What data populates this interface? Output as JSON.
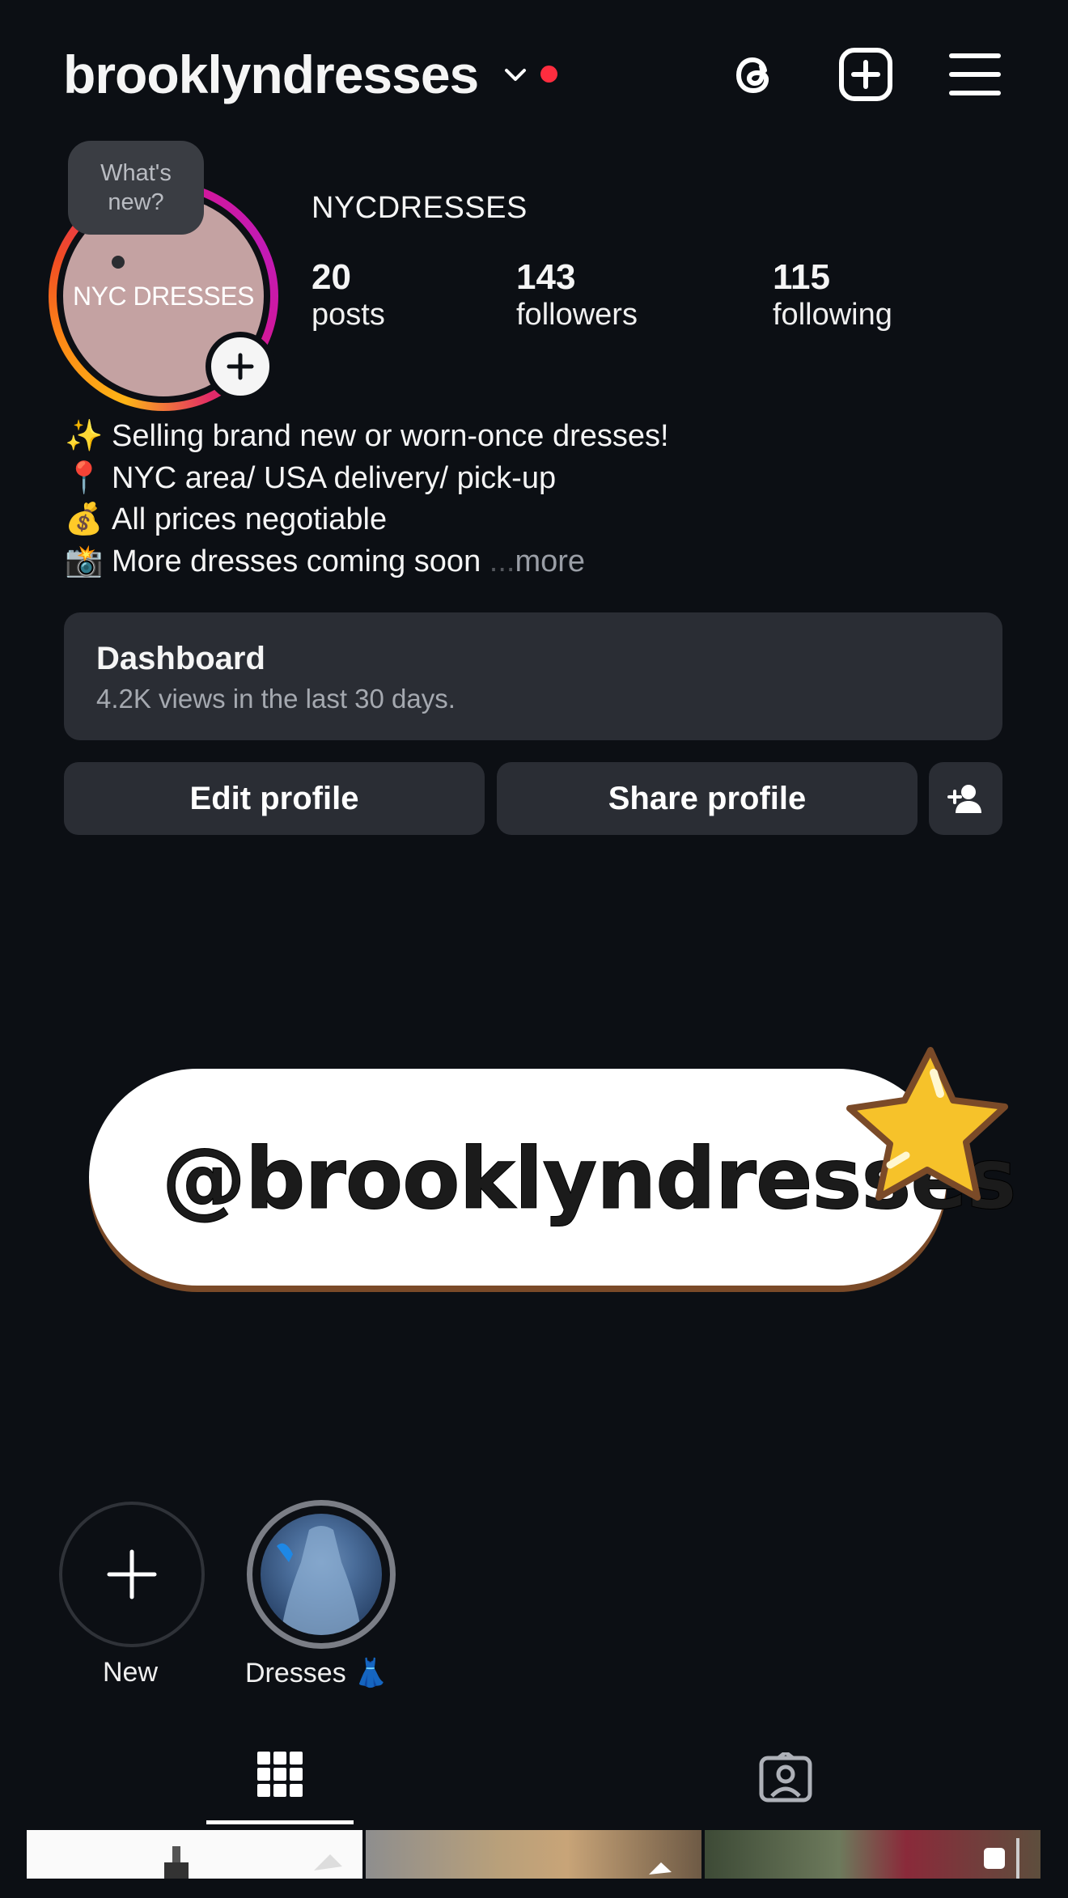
{
  "header": {
    "username": "brooklyndresses",
    "icons": [
      "chevron-down-icon",
      "threads-icon",
      "create-post-icon",
      "hamburger-menu-icon"
    ],
    "notification_color": "#ff2d3f"
  },
  "profile": {
    "avatar_text": "NYC DRESSES",
    "note_bubble": "What's new?",
    "display_name": "NYCDRESSES",
    "stats": [
      {
        "number": "20",
        "label": "posts"
      },
      {
        "number": "143",
        "label": "followers"
      },
      {
        "number": "115",
        "label": "following"
      }
    ]
  },
  "bio": {
    "lines": [
      {
        "emoji": "✨",
        "text": "Selling brand new or worn-once dresses!"
      },
      {
        "emoji": "📍",
        "text": "NYC area/ USA delivery/ pick-up"
      },
      {
        "emoji": "💰",
        "text": "All prices negotiable"
      },
      {
        "emoji": "📸",
        "text": "More dresses coming soon"
      }
    ],
    "ellipsis": "...",
    "more_label": "more"
  },
  "dashboard": {
    "title": "Dashboard",
    "subtitle": "4.2K views in the last 30 days."
  },
  "actions": {
    "edit_label": "Edit profile",
    "share_label": "Share profile"
  },
  "sticker": {
    "text": "@brooklyndresses"
  },
  "highlights": [
    {
      "label": "New"
    },
    {
      "label": "Dresses 👗"
    }
  ],
  "tabs": [
    "grid-icon",
    "tagged-icon"
  ]
}
